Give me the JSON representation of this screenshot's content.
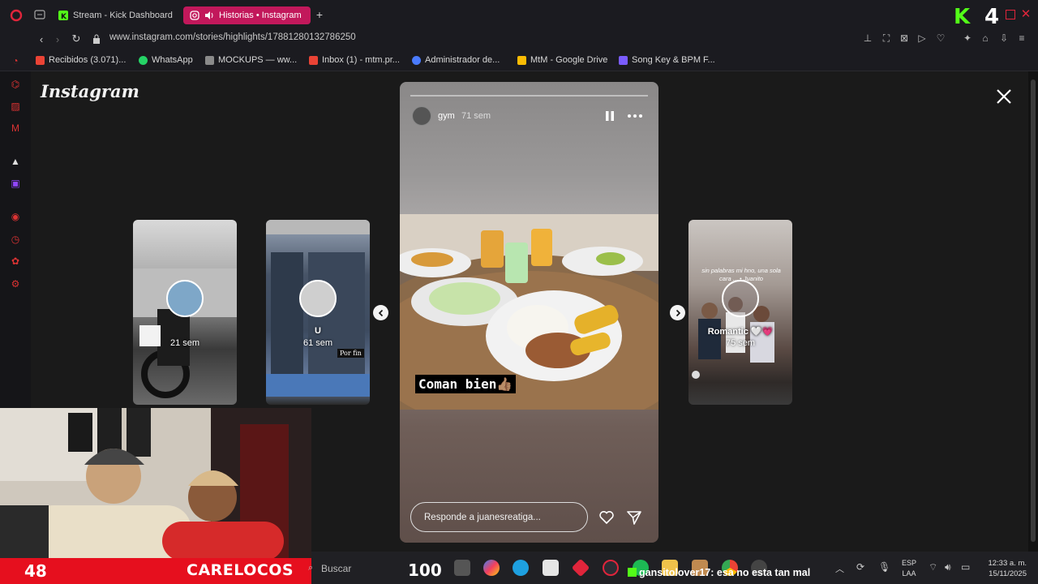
{
  "browser": {
    "tabs": [
      {
        "label": "Stream - Kick Dashboard"
      },
      {
        "label": "Historias • Instagram"
      }
    ],
    "url": "www.instagram.com/stories/highlights/17881280132786250",
    "bookmarks": [
      {
        "label": "Recibidos (3.071)...",
        "color": "#ea4335"
      },
      {
        "label": "WhatsApp",
        "color": "#25d366"
      },
      {
        "label": "MOCKUPS — ww...",
        "color": "#8a8a8a"
      },
      {
        "label": "Inbox (1) - mtm.pr...",
        "color": "#ea4335"
      },
      {
        "label": "Administrador de...",
        "color": "#4a7bff"
      },
      {
        "label": "MtM - Google Drive",
        "color": "#fbbc04"
      },
      {
        "label": "Song Key & BPM F...",
        "color": "#7a5cff"
      }
    ]
  },
  "instagram": {
    "logo": "Instagram",
    "story": {
      "username": "gym",
      "time": "71 sem",
      "caption": "Coman bien👍🏽",
      "reply_placeholder": "Responde a juanesreatiga..."
    },
    "side_cards": [
      {
        "name": "",
        "time": "21 sem"
      },
      {
        "name": "U",
        "time": "61 sem",
        "tag": "Por fin"
      },
      {
        "name": "Romantic 🤍💗",
        "time": "75 sem",
        "overlay_text": "sin palabras mi hno, una sola cara ... • Juanito"
      }
    ]
  },
  "stream_overlay": {
    "viewer_count": "48",
    "channel_name": "CARELOCOS",
    "kick_counter": "4"
  },
  "taskbar": {
    "search_label": "Buscar",
    "badge": "100",
    "chat_user": "gansitolover17",
    "chat_message": ": esa no esta tan mal",
    "lang_top": "ESP",
    "lang_bottom": "LAA",
    "time": "12:33 a. m.",
    "date": "15/11/2025"
  }
}
